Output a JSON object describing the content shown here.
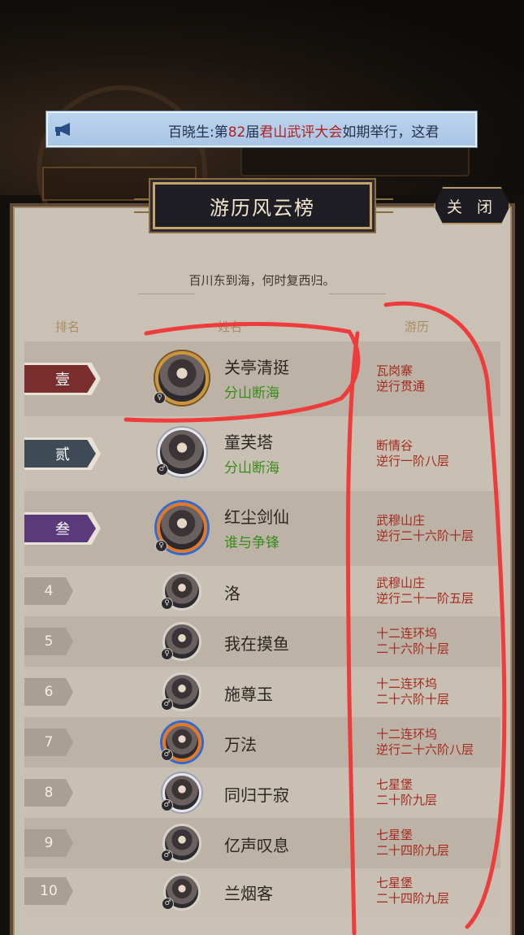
{
  "announcement": {
    "speaker": "百晓生",
    "prefix": "百晓生:第",
    "session_no": "82",
    "mid": "届",
    "event_name": "君山武评大会",
    "suffix": "如期举行，这君"
  },
  "panel": {
    "title": "游历风云榜",
    "close_label": "关 闭",
    "subtitle": "百川东到海，何时复西归。",
    "columns": {
      "rank": "排名",
      "name": "姓名",
      "travel": "游历"
    }
  },
  "rows": [
    {
      "rank": "壹",
      "name": "关亭清挺",
      "sect": "分山断海",
      "loc_line1": "瓦岗寨",
      "loc_line2": "逆行贯通",
      "gender": "♀",
      "tag_color": "#7a2d2d"
    },
    {
      "rank": "贰",
      "name": "童芙塔",
      "sect": "分山断海",
      "loc_line1": "断情谷",
      "loc_line2": "逆行一阶八层",
      "gender": "♂",
      "tag_color": "#3e4a56"
    },
    {
      "rank": "叁",
      "name": "红尘剑仙",
      "sect": "谁与争锋",
      "loc_line1": "武穆山庄",
      "loc_line2": "逆行二十六阶十层",
      "gender": "♀",
      "tag_color": "#5a3a7a"
    },
    {
      "rank": "4",
      "name": "洛",
      "sect": "",
      "loc_line1": "武穆山庄",
      "loc_line2": "逆行二十一阶五层",
      "gender": "♀"
    },
    {
      "rank": "5",
      "name": "我在摸鱼",
      "sect": "",
      "loc_line1": "十二连环坞",
      "loc_line2": "二十六阶十层",
      "gender": "♀"
    },
    {
      "rank": "6",
      "name": "施尊玉",
      "sect": "",
      "loc_line1": "十二连环坞",
      "loc_line2": "二十六阶十层",
      "gender": "♂"
    },
    {
      "rank": "7",
      "name": "万法",
      "sect": "",
      "loc_line1": "十二连环坞",
      "loc_line2": "逆行二十六阶八层",
      "gender": "♂"
    },
    {
      "rank": "8",
      "name": "同归于寂",
      "sect": "",
      "loc_line1": "七星堡",
      "loc_line2": "二十阶九层",
      "gender": "♂"
    },
    {
      "rank": "9",
      "name": "亿声叹息",
      "sect": "",
      "loc_line1": "七星堡",
      "loc_line2": "二十四阶九层",
      "gender": "♂"
    },
    {
      "rank": "10",
      "name": "兰烟客",
      "sect": "",
      "loc_line1": "七星堡",
      "loc_line2": "二十四阶九层",
      "gender": "♂"
    }
  ],
  "colors": {
    "location_red": "#a52a20",
    "sect_green": "#3a8a1c",
    "annotation_red": "#ee3b3b"
  },
  "icons": [
    "megaphone-icon",
    "close-icon",
    "avatar",
    "gender-icon"
  ]
}
